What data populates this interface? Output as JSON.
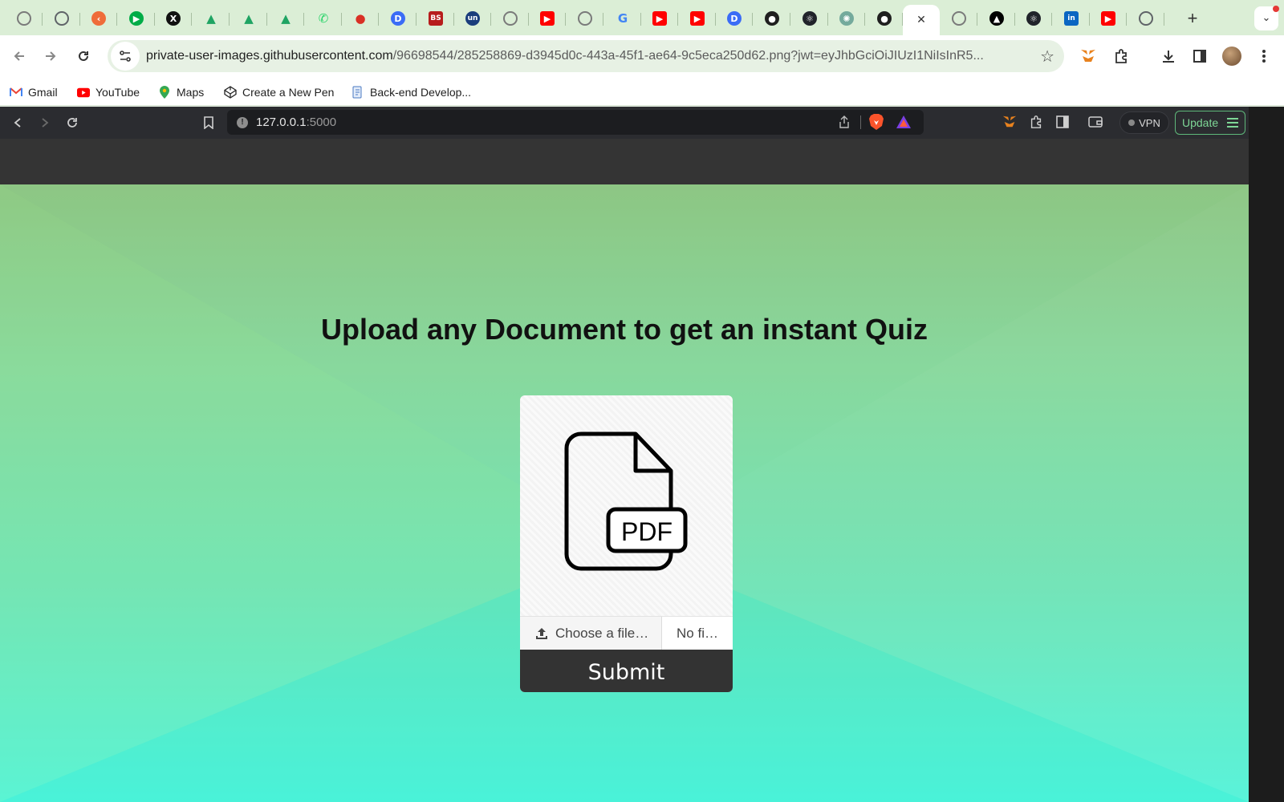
{
  "outer_browser": {
    "tabs": [
      {
        "icon": "globe-icon",
        "color": "#7a7a7a",
        "glyph": ""
      },
      {
        "icon": "chrome-icon",
        "color": "#5f6368",
        "glyph": ""
      },
      {
        "icon": "codepen-orange-icon",
        "color": "#ef6c3a",
        "glyph": "‹"
      },
      {
        "icon": "google-meet-icon",
        "color": "#00ac47",
        "glyph": "▶"
      },
      {
        "icon": "x-icon",
        "color": "#111111",
        "glyph": "X"
      },
      {
        "icon": "google-drive-icon",
        "color": "#1fa463",
        "glyph": "▲"
      },
      {
        "icon": "google-drive-icon",
        "color": "#1fa463",
        "glyph": "▲"
      },
      {
        "icon": "google-drive-icon",
        "color": "#1fa463",
        "glyph": "▲"
      },
      {
        "icon": "whatsapp-icon",
        "color": "#25d366",
        "glyph": "✆"
      },
      {
        "icon": "record-icon",
        "color": "#d93025",
        "glyph": "●"
      },
      {
        "icon": "blue-d-icon",
        "color": "#3b6cf6",
        "glyph": "D"
      },
      {
        "icon": "bs-icon",
        "color": "#b71c1c",
        "glyph": "BS"
      },
      {
        "icon": "un-icon",
        "color": "#1a3d7c",
        "glyph": "un"
      },
      {
        "icon": "globe-icon",
        "color": "#7a7a7a",
        "glyph": ""
      },
      {
        "icon": "youtube-icon",
        "color": "#ff0000",
        "glyph": "▶"
      },
      {
        "icon": "globe-icon",
        "color": "#7a7a7a",
        "glyph": ""
      },
      {
        "icon": "google-icon",
        "color": "#4285f4",
        "glyph": "G"
      },
      {
        "icon": "youtube-icon",
        "color": "#ff0000",
        "glyph": "▶"
      },
      {
        "icon": "youtube-icon",
        "color": "#ff0000",
        "glyph": "▶"
      },
      {
        "icon": "blue-d-icon",
        "color": "#3b6cf6",
        "glyph": "D"
      },
      {
        "icon": "github-icon",
        "color": "#1f1f1f",
        "glyph": "●"
      },
      {
        "icon": "react-icon",
        "color": "#20232a",
        "glyph": "⚛"
      },
      {
        "icon": "chatgpt-icon",
        "color": "#74aa9c",
        "glyph": "✺"
      },
      {
        "icon": "github-icon",
        "color": "#1f1f1f",
        "glyph": "●"
      },
      {
        "icon": "close-icon",
        "color": "#ffffff",
        "glyph": "✕",
        "active": true
      },
      {
        "icon": "globe-icon",
        "color": "#7a7a7a",
        "glyph": ""
      },
      {
        "icon": "triangle-icon",
        "color": "#000000",
        "glyph": "▲"
      },
      {
        "icon": "react-icon",
        "color": "#20232a",
        "glyph": "⚛"
      },
      {
        "icon": "linkedin-icon",
        "color": "#0a66c2",
        "glyph": "in"
      },
      {
        "icon": "youtube-icon",
        "color": "#ff0000",
        "glyph": "▶"
      },
      {
        "icon": "chrome-icon",
        "color": "#5f6368",
        "glyph": ""
      }
    ],
    "new_tab_label": "+",
    "url_host": "private-user-images.githubusercontent.com",
    "url_path": "/96698544/285258869-d3945d0c-443a-45f1-ae64-9c5eca250d62.png?jwt=eyJhbGciOiJIUzI1NiIsInR5...",
    "bookmarks": [
      {
        "label": "Gmail",
        "icon": "gmail-icon"
      },
      {
        "label": "YouTube",
        "icon": "youtube-icon"
      },
      {
        "label": "Maps",
        "icon": "maps-icon"
      },
      {
        "label": "Create a New Pen",
        "icon": "codepen-icon"
      },
      {
        "label": "Back-end Develop...",
        "icon": "document-icon"
      }
    ]
  },
  "inner_browser": {
    "url_host": "127.0.0.1",
    "url_port": ":5000",
    "vpn_label": "VPN",
    "update_label": "Update"
  },
  "page": {
    "headline": "Upload any Document to get an instant Quiz",
    "illustration_text": "PDF",
    "choose_file_label": "Choose a file…",
    "no_file_label": "No fi…",
    "submit_label": "Submit"
  },
  "colors": {
    "gradient_top": "#89c47f",
    "gradient_bottom": "#4ff3d8",
    "submit_bg": "#333333",
    "navbar_bg": "#343434"
  }
}
